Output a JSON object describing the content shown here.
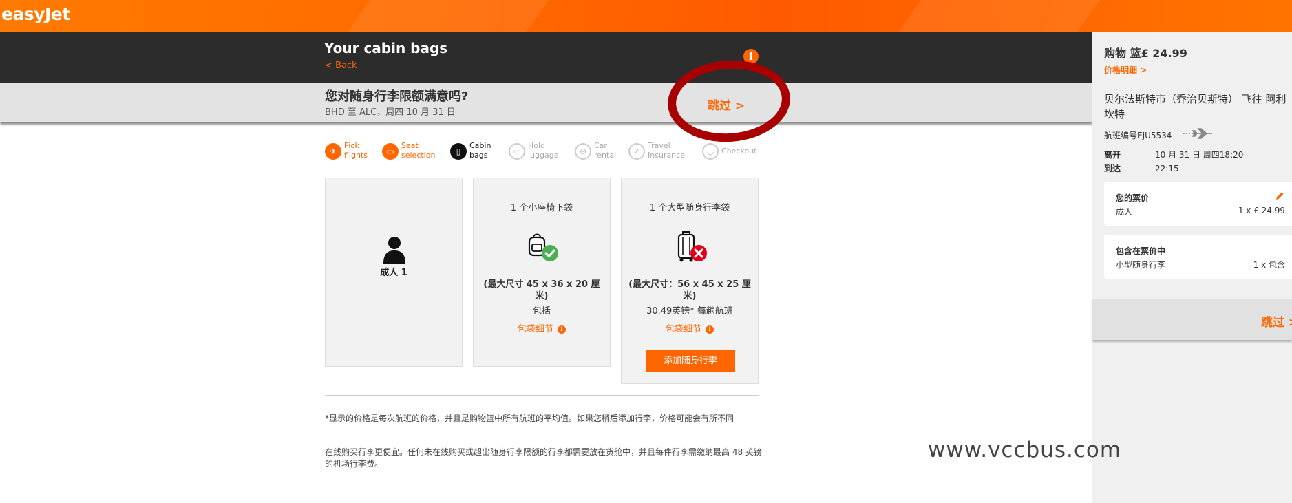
{
  "brand": {
    "logo_text": "easyJet",
    "accent": "#ff6600"
  },
  "header": {
    "title": "Your cabin bags",
    "back_label": "< Back",
    "info_icon": "i"
  },
  "question_bar": {
    "question": "您对随身行李限额满意吗?",
    "route_date": "BHD 至 ALC，周四 10 月 31 日",
    "skip_label": "跳过 >"
  },
  "steps": [
    {
      "label": "Pick\nflights",
      "state": "done",
      "icon": "plane-icon"
    },
    {
      "label": "Seat\nselection",
      "state": "done",
      "icon": "seat-icon"
    },
    {
      "label": "Cabin\nbags",
      "state": "current",
      "icon": "cabin-bag-icon"
    },
    {
      "label": "Hold\nluggage",
      "state": "todo",
      "icon": "hold-luggage-icon"
    },
    {
      "label": "Car\nrental",
      "state": "todo",
      "icon": "car-icon"
    },
    {
      "label": "Travel\nInsurance",
      "state": "todo",
      "icon": "shield-icon"
    },
    {
      "label": "Checkout",
      "state": "todo",
      "icon": "basket-icon"
    }
  ],
  "cards": {
    "passenger": {
      "label": "成人 1"
    },
    "small_bag": {
      "title": "1 个小座椅下袋",
      "size": "(最大尺寸 45 x 36 x 20 厘米)",
      "price": "包括",
      "details": "包袋细节"
    },
    "large_bag": {
      "title": "1 个大型随身行李袋",
      "size": "(最大尺寸：56 x 45 x 25 厘米)",
      "price": "30.49英镑* 每趟航班",
      "details": "包袋细节",
      "add_button": "添加随身行李"
    }
  },
  "notes": {
    "note1": "*显示的价格是每次航班的价格，并且是购物篮中所有航班的平均值。如果您稍后添加行李，价格可能会有所不同",
    "note2": "在线购买行李更便宜。任何未在线购买或超出随身行李限额的行李都需要放在货舱中，并且每件行李需缴纳最高 48 英镑的机场行李费。"
  },
  "sidebar": {
    "basket_title": "购物 篮£ 24.99",
    "price_details": "价格明细 >",
    "route_line1": "贝尔法斯特市（乔治贝斯特） 飞往 阿利",
    "route_line2": "坎特",
    "flight_number": "航班编号EJU5534",
    "depart_label": "离开",
    "depart_value": "10 月 31 日 周四18:20",
    "arrive_label": "到达",
    "arrive_value": "22:15",
    "fare_title": "您的票价",
    "fare_passenger": "成人",
    "fare_amount": "1 x £ 24.99",
    "included_title": "包含在票价中",
    "included_item": "小型随身行李",
    "included_qty": "1 x 包含",
    "skip_label": "跳过 >"
  },
  "watermark": "www.vccbus.com"
}
